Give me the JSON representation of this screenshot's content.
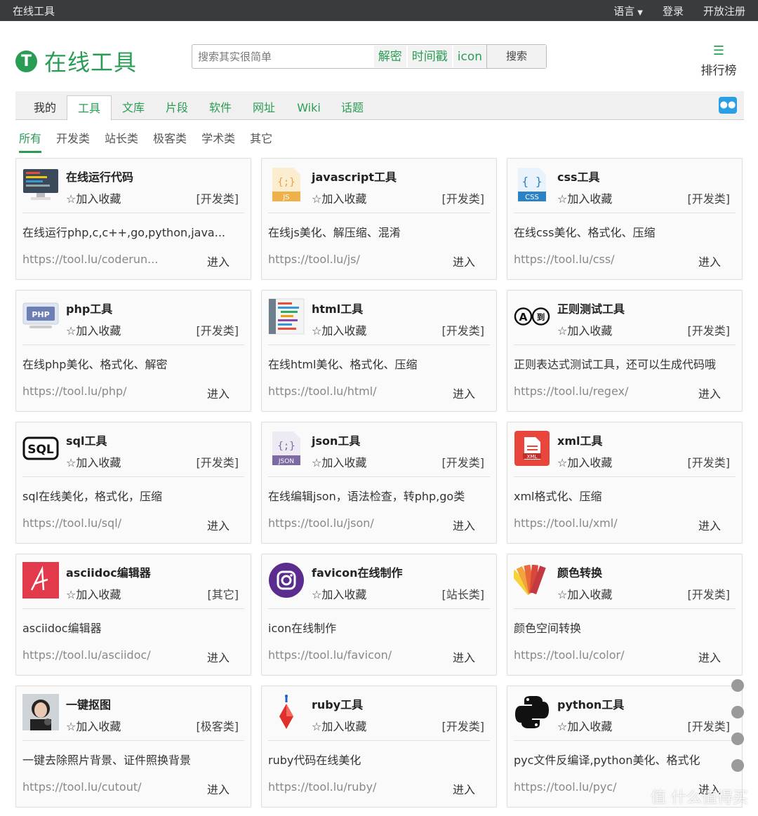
{
  "topbar": {
    "site": "在线工具",
    "lang": "语言",
    "login": "登录",
    "register": "开放注册"
  },
  "header": {
    "logo_text": "在线工具",
    "logo_letter": "T",
    "search_placeholder": "搜索其实很简单",
    "hot": [
      "解密",
      "时间戳",
      "icon"
    ],
    "search_button": "搜索",
    "rank_label": "排行榜"
  },
  "tabs": [
    "我的",
    "工具",
    "文库",
    "片段",
    "软件",
    "网址",
    "Wiki",
    "话题"
  ],
  "active_tab": "工具",
  "subtabs": [
    "所有",
    "开发类",
    "站长类",
    "极客类",
    "学术类",
    "其它"
  ],
  "fav_label": "加入收藏",
  "enter_label": "进入",
  "accent_color": "#2a9d55",
  "cards": [
    {
      "title": "在线运行代码",
      "cat": "[开发类]",
      "desc": "在线运行php,c,c++,go,python,java...",
      "url": "https://tool.lu/coderun...",
      "icon": "monitor-icon"
    },
    {
      "title": "javascript工具",
      "cat": "[开发类]",
      "desc": "在线js美化、解压缩、混淆",
      "url": "https://tool.lu/js/",
      "icon": "js-file-icon"
    },
    {
      "title": "css工具",
      "cat": "[开发类]",
      "desc": "在线css美化、格式化、压缩",
      "url": "https://tool.lu/css/",
      "icon": "css-file-icon"
    },
    {
      "title": "php工具",
      "cat": "[开发类]",
      "desc": "在线php美化、格式化、解密",
      "url": "https://tool.lu/php/",
      "icon": "php-icon"
    },
    {
      "title": "html工具",
      "cat": "[开发类]",
      "desc": "在线html美化、格式化、压缩",
      "url": "https://tool.lu/html/",
      "icon": "html-code-icon"
    },
    {
      "title": "正则测试工具",
      "cat": "[开发类]",
      "desc": "正则表达式测试工具，还可以生成代码哦",
      "url": "https://tool.lu/regex/",
      "icon": "regex-icon"
    },
    {
      "title": "sql工具",
      "cat": "[开发类]",
      "desc": "sql在线美化，格式化，压缩",
      "url": "https://tool.lu/sql/",
      "icon": "sql-icon"
    },
    {
      "title": "json工具",
      "cat": "[开发类]",
      "desc": "在线编辑json，语法检查，转php,go类",
      "url": "https://tool.lu/json/",
      "icon": "json-file-icon"
    },
    {
      "title": "xml工具",
      "cat": "[开发类]",
      "desc": "xml格式化、压缩",
      "url": "https://tool.lu/xml/",
      "icon": "xml-file-icon"
    },
    {
      "title": "asciidoc编辑器",
      "cat": "[其它]",
      "desc": "asciidoc编辑器",
      "url": "https://tool.lu/asciidoc/",
      "icon": "asciidoc-icon"
    },
    {
      "title": "favicon在线制作",
      "cat": "[站长类]",
      "desc": "icon在线制作",
      "url": "https://tool.lu/favicon/",
      "icon": "favicon-icon"
    },
    {
      "title": "颜色转换",
      "cat": "[开发类]",
      "desc": "颜色空间转换",
      "url": "https://tool.lu/color/",
      "icon": "color-swatch-icon"
    },
    {
      "title": "一键抠图",
      "cat": "[极客类]",
      "desc": "一键去除照片背景、证件照换背景",
      "url": "https://tool.lu/cutout/",
      "icon": "portrait-icon"
    },
    {
      "title": "ruby工具",
      "cat": "[开发类]",
      "desc": "ruby代码在线美化",
      "url": "https://tool.lu/ruby/",
      "icon": "ruby-icon"
    },
    {
      "title": "python工具",
      "cat": "[开发类]",
      "desc": "pyc文件反编译,python美化、格式化",
      "url": "https://tool.lu/pyc/",
      "icon": "python-icon"
    }
  ],
  "watermark": "值 什么值得买"
}
